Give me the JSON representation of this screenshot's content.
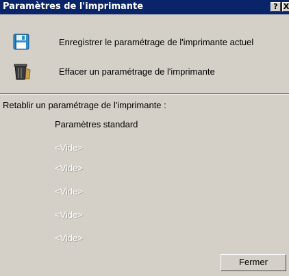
{
  "window": {
    "title": "Paramètres de l'imprimante",
    "help_label": "?",
    "close_label": "X"
  },
  "actions": {
    "save": {
      "label": "Enregistrer le paramétrage de l'imprimante actuel",
      "icon": "floppy-disk-icon"
    },
    "delete": {
      "label": "Effacer un paramétrage de l'imprimante",
      "icon": "trash-can-icon"
    }
  },
  "restore": {
    "title": "Retablir un paramétrage de l'imprimante :",
    "presets": [
      "Paramètres standard",
      "<Vide>",
      "<Vide>",
      "<Vide>",
      "<Vide>",
      "<Vide>"
    ]
  },
  "footer": {
    "close_button": "Fermer"
  },
  "colors": {
    "titlebar": "#0a246a",
    "dialog": "#d4d0c8"
  }
}
